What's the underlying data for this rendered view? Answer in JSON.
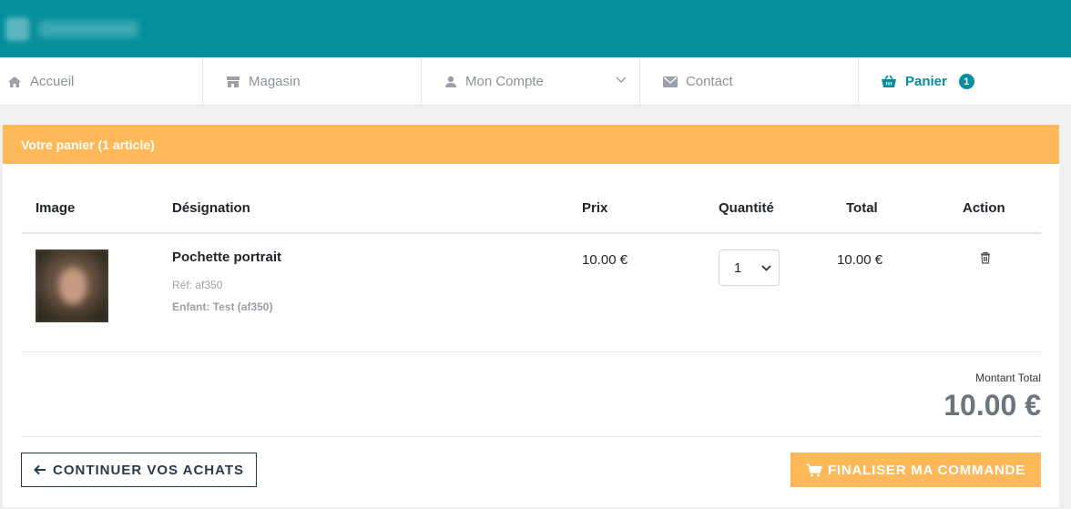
{
  "nav": {
    "items": [
      {
        "label": "Accueil",
        "icon": "home-icon"
      },
      {
        "label": "Magasin",
        "icon": "store-icon"
      },
      {
        "label": "Mon Compte",
        "icon": "user-icon"
      },
      {
        "label": "Contact",
        "icon": "envelope-icon"
      },
      {
        "label": "Panier",
        "icon": "basket-icon",
        "badge": "1",
        "active": true
      }
    ]
  },
  "cart": {
    "title": "Votre panier (1 article)",
    "columns": {
      "image": "Image",
      "designation": "Désignation",
      "price": "Prix",
      "quantity": "Quantité",
      "total": "Total",
      "action": "Action"
    },
    "items": [
      {
        "name": "Pochette portrait",
        "ref": "Réf: af350",
        "child": "Enfant: Test (af350)",
        "price": "10.00 €",
        "quantity": "1",
        "total": "10.00 €"
      }
    ],
    "summary": {
      "label": "Montant Total",
      "value": "10.00 €"
    },
    "buttons": {
      "continue": "CONTINUER VOS ACHATS",
      "checkout": "FINALISER MA COMMANDE"
    }
  },
  "colors": {
    "brand": "#058f9d",
    "accent": "#fcb859",
    "muted": "#6c757d"
  }
}
